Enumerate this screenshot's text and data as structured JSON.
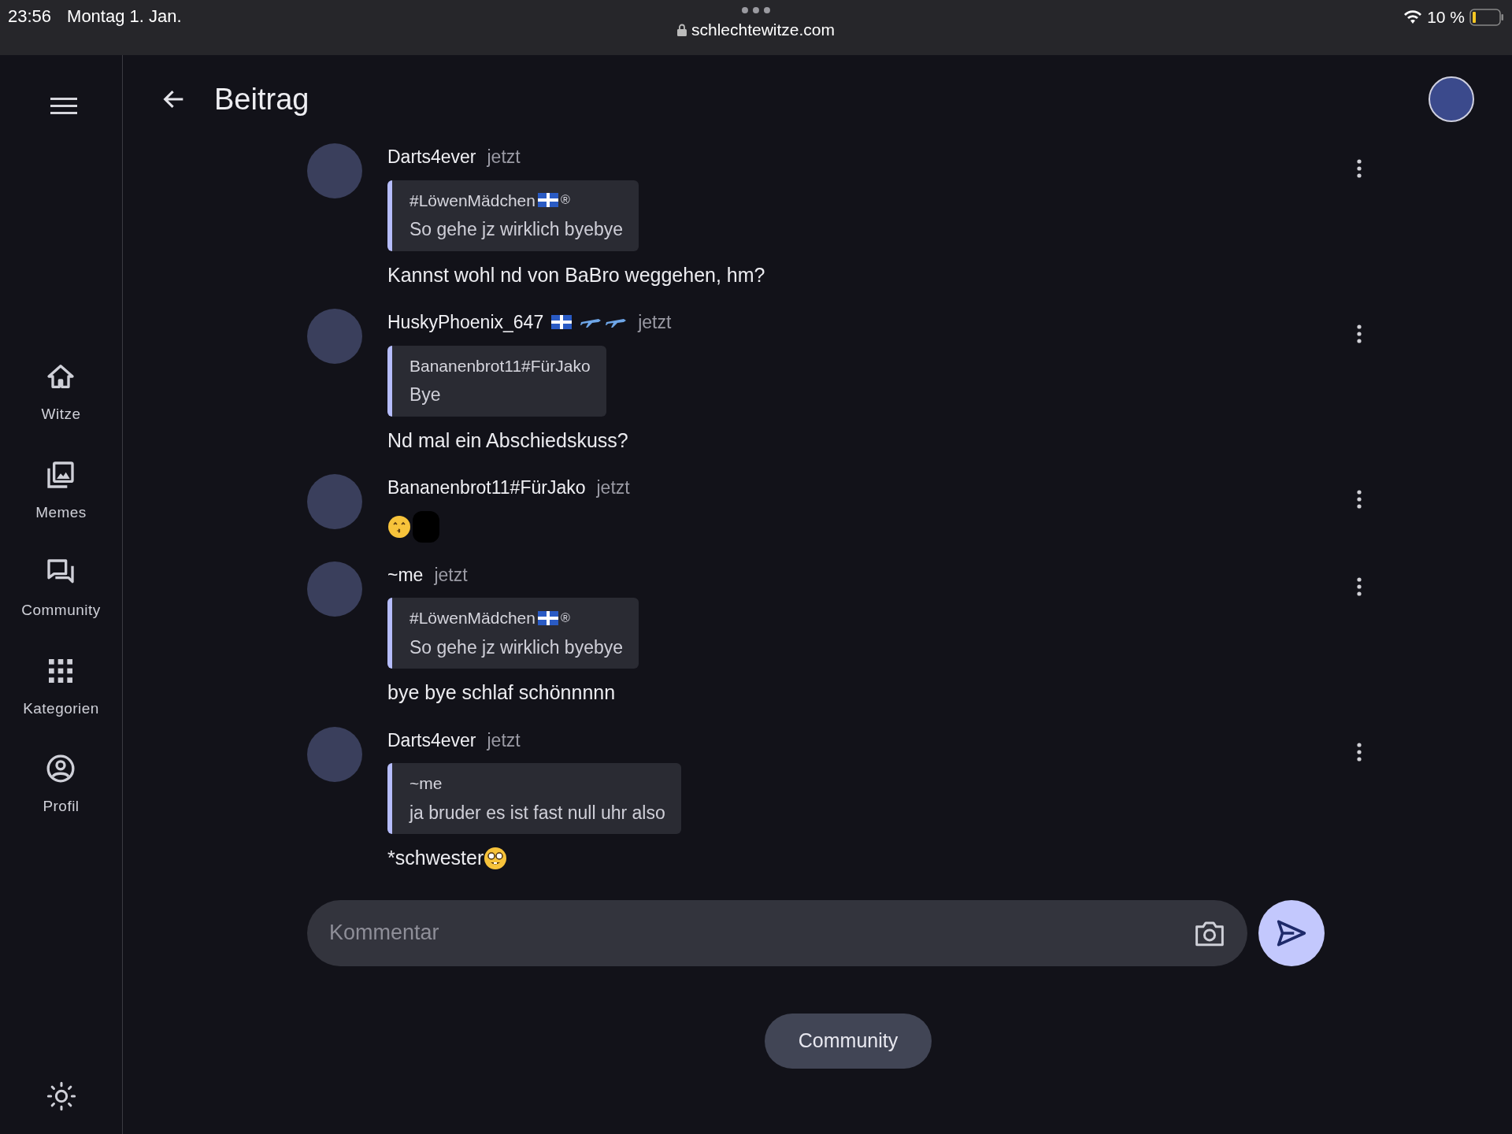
{
  "status_bar": {
    "time": "23:56",
    "date": "Montag 1. Jan.",
    "url": "schlechtewitze.com",
    "battery": "10 %"
  },
  "sidebar": {
    "items": [
      {
        "label": "Witze"
      },
      {
        "label": "Memes"
      },
      {
        "label": "Community"
      },
      {
        "label": "Kategorien"
      },
      {
        "label": "Profil"
      }
    ]
  },
  "header": {
    "title": "Beitrag"
  },
  "comments": [
    {
      "author": "Darts4ever",
      "time": "jetzt",
      "quote": {
        "author": "#LöwenMädchen",
        "flag_badge": true,
        "author_suffix": "®",
        "text": "So gehe jz wirklich byebye"
      },
      "text": "Kannst wohl nd von BaBro weggehen, hm?"
    },
    {
      "author": "HuskyPhoenix_647",
      "flag_badge": true,
      "plane_badges": true,
      "time": "jetzt",
      "quote": {
        "author": "Bananenbrot11#FürJako",
        "text": "Bye"
      },
      "text": "Nd mal ein Abschiedskuss?"
    },
    {
      "author": "Bananenbrot11#FürJako",
      "time": "jetzt",
      "kiss_emoji": true,
      "redacted": true
    },
    {
      "author": "~me",
      "time": "jetzt",
      "quote": {
        "author": "#LöwenMädchen",
        "flag_badge": true,
        "author_suffix": "®",
        "text": "So gehe jz wirklich byebye"
      },
      "text": "bye bye schlaf schönnnnn"
    },
    {
      "author": "Darts4ever",
      "time": "jetzt",
      "quote": {
        "author": "~me",
        "text": "ja bruder es ist fast null uhr also"
      },
      "text": "*schwester",
      "nerd_emoji": true
    }
  ],
  "comment_field": {
    "placeholder": "Kommentar"
  },
  "community_button": {
    "label": "Community"
  }
}
